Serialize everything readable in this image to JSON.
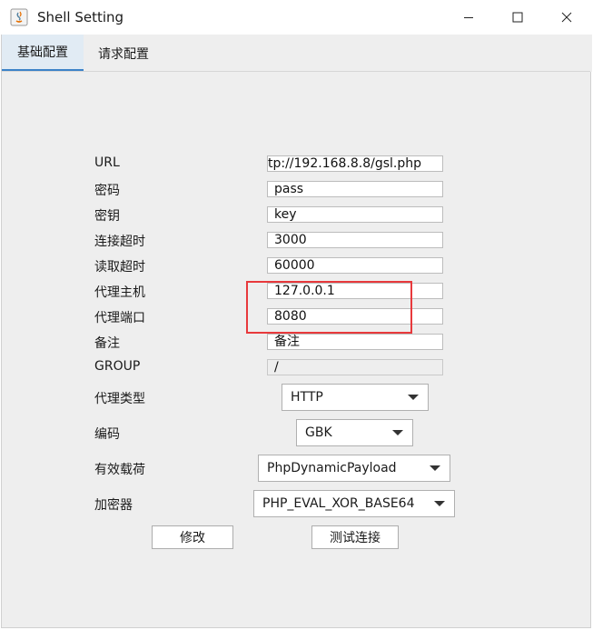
{
  "window": {
    "title": "Shell Setting"
  },
  "tabs": [
    {
      "label": "基础配置",
      "active": true
    },
    {
      "label": "请求配置",
      "active": false
    }
  ],
  "form": {
    "url": {
      "label": "URL",
      "value": "tp://192.168.8.8/gsl.php"
    },
    "password": {
      "label": "密码",
      "value": "pass"
    },
    "key": {
      "label": "密钥",
      "value": "key"
    },
    "conn_timeout": {
      "label": "连接超时",
      "value": "3000"
    },
    "read_timeout": {
      "label": "读取超时",
      "value": "60000"
    },
    "proxy_host": {
      "label": "代理主机",
      "value": "127.0.0.1"
    },
    "proxy_port": {
      "label": "代理端口",
      "value": "8080"
    },
    "remark": {
      "label": "备注",
      "value": "备注"
    },
    "group": {
      "label": "GROUP",
      "value": "/"
    },
    "proxy_type": {
      "label": "代理类型",
      "value": "HTTP"
    },
    "encoding": {
      "label": "编码",
      "value": "GBK"
    },
    "payload": {
      "label": "有效载荷",
      "value": "PhpDynamicPayload"
    },
    "cryption": {
      "label": "加密器",
      "value": "PHP_EVAL_XOR_BASE64"
    }
  },
  "buttons": {
    "modify": "修改",
    "test": "测试连接"
  },
  "colors": {
    "tab_accent": "#3b82c8",
    "highlight": "#e8393c"
  }
}
